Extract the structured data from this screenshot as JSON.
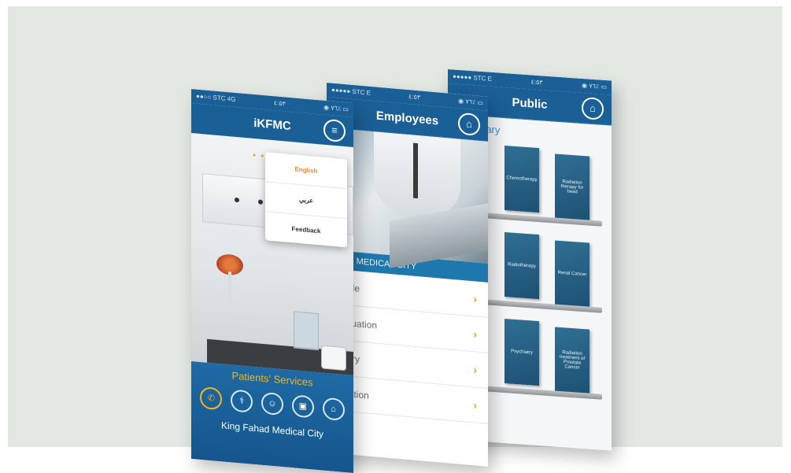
{
  "public_screen": {
    "status": {
      "left": "●●●●● STC  E",
      "center": "٤:٥٣",
      "right": "◉ ٧٦٪ ▭"
    },
    "title": "Public",
    "home_icon": "home-icon",
    "library_label": "rary",
    "books": [
      [
        "",
        "Chemotherapy",
        "Radiation therapy for head"
      ],
      [
        "",
        "Radiotherapy",
        "Renal Cancer"
      ],
      [
        "",
        "Psychiatry",
        "Radiation treatment of Prostate Cancer"
      ]
    ]
  },
  "employees_screen": {
    "status": {
      "left": "●●●●● STC  E",
      "center": "٤:٥٣",
      "right": "◉ ٧٦٪ ▭"
    },
    "title": "Employees",
    "home_icon": "home-icon",
    "banner": "AHAD MEDICAL CITY",
    "menu": [
      {
        "label": "Profile",
        "chevron": "›"
      },
      {
        "label": "Evaluation",
        "chevron": "›"
      },
      {
        "label": "Salary",
        "chevron": "›"
      },
      {
        "label": "Vacation",
        "chevron": "›"
      }
    ]
  },
  "ikfmc_screen": {
    "status": {
      "left": "●●○○ STC  4G",
      "center": "٤:٥٣",
      "right": "◉ ٧٦٪ ▭"
    },
    "title": "iKFMC",
    "menu_icon": "hamburger-icon",
    "page_dots": "● ● ●",
    "popup": {
      "english": "English",
      "arabic": "عربي",
      "feedback": "Feedback"
    },
    "services_title": "Patients' Services",
    "service_icons": [
      "phone-icon",
      "doctor-icon",
      "patient-icon",
      "briefcase-icon",
      "home-icon"
    ],
    "footer": "King Fahad Medical City"
  },
  "colors": {
    "primary": "#1b5f97",
    "accent": "#f3b51c",
    "chevron": "#f0a020"
  }
}
